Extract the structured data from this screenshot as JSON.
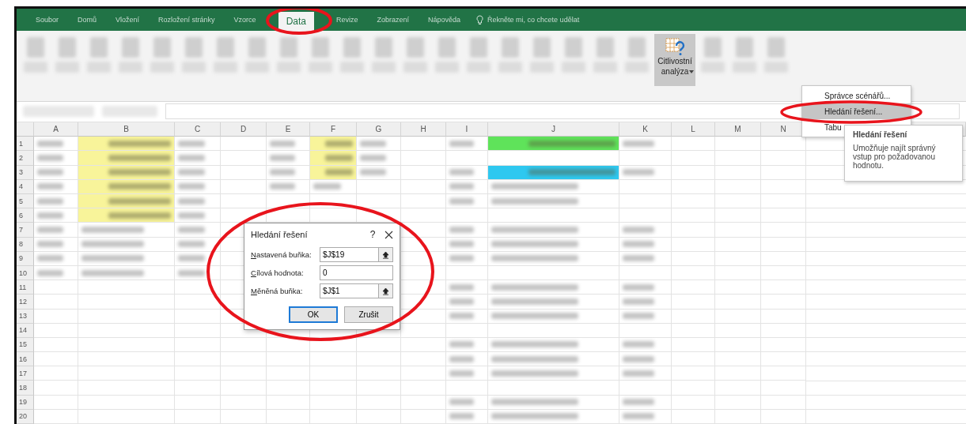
{
  "ribbon_tabs": [
    {
      "label": "Soubor",
      "selected": false
    },
    {
      "label": "Domů",
      "selected": false
    },
    {
      "label": "Vložení",
      "selected": false
    },
    {
      "label": "Rozložení stránky",
      "selected": false
    },
    {
      "label": "Vzorce",
      "selected": false
    },
    {
      "label": "Data",
      "selected": true
    },
    {
      "label": "Revize",
      "selected": false
    },
    {
      "label": "Zobrazení",
      "selected": false
    },
    {
      "label": "Nápověda",
      "selected": false
    }
  ],
  "tell_me": {
    "placeholder": "Řekněte mi, co chcete udělat"
  },
  "ribbon_items": [
    {
      "kind": "blurred"
    },
    {
      "kind": "blurred"
    },
    {
      "kind": "blurred"
    },
    {
      "kind": "blurred"
    },
    {
      "kind": "blurred"
    },
    {
      "kind": "blurred"
    },
    {
      "kind": "blurred"
    },
    {
      "kind": "blurred"
    },
    {
      "kind": "blurred"
    },
    {
      "kind": "blurred"
    },
    {
      "kind": "blurred"
    },
    {
      "kind": "blurred"
    },
    {
      "kind": "blurred"
    },
    {
      "kind": "blurred"
    },
    {
      "kind": "blurred"
    },
    {
      "kind": "blurred"
    },
    {
      "kind": "blurred"
    },
    {
      "kind": "blurred"
    },
    {
      "kind": "blurred"
    },
    {
      "kind": "blurred"
    },
    {
      "kind": "button",
      "lines": [
        "Citlivostní",
        "analýza"
      ],
      "pressed": true
    },
    {
      "kind": "blurred"
    },
    {
      "kind": "blurred"
    },
    {
      "kind": "blurred"
    }
  ],
  "dropdown_menu": {
    "items": [
      {
        "label": "Správce scénářů...",
        "highlighted": false
      },
      {
        "label": "Hledání řešení...",
        "highlighted": true
      },
      {
        "label": "Tabu",
        "highlighted": false
      }
    ]
  },
  "tooltip": {
    "title": "Hledání řešení",
    "text": "Umožňuje najít správný vstup pro požadovanou hodnotu."
  },
  "columns": [
    "A",
    "B",
    "C",
    "D",
    "E",
    "F",
    "G",
    "H",
    "I",
    "J",
    "K",
    "L",
    "M",
    "N"
  ],
  "rows": [
    {
      "number": "1",
      "cells": [
        {
          "blurred": true
        },
        {
          "blurred": true,
          "color": "#f8f49a"
        },
        {
          "blurred": true
        },
        {
          "blurred": false
        },
        {
          "blurred": true
        },
        {
          "blurred": true,
          "color": "#f8f49a"
        },
        {
          "blurred": true
        },
        {
          "blurred": false
        },
        {
          "blurred": true
        },
        {
          "blurred": true,
          "color": "#5fe35a"
        },
        {
          "blurred": true
        },
        {
          "blurred": false
        },
        {
          "blurred": false
        },
        {
          "blurred": false
        }
      ]
    },
    {
      "number": "2",
      "cells": [
        {
          "blurred": true
        },
        {
          "blurred": true,
          "color": "#f8f49a"
        },
        {
          "blurred": true
        },
        {
          "blurred": false
        },
        {
          "blurred": true
        },
        {
          "blurred": true,
          "color": "#f8f49a"
        },
        {
          "blurred": true
        },
        {
          "blurred": false
        },
        {
          "blurred": false
        },
        {
          "blurred": false
        },
        {
          "blurred": false
        },
        {
          "blurred": false
        },
        {
          "blurred": false
        },
        {
          "blurred": false
        }
      ]
    },
    {
      "number": "3",
      "cells": [
        {
          "blurred": true
        },
        {
          "blurred": true,
          "color": "#f8f49a"
        },
        {
          "blurred": true
        },
        {
          "blurred": false
        },
        {
          "blurred": true
        },
        {
          "blurred": true,
          "color": "#f8f49a"
        },
        {
          "blurred": true
        },
        {
          "blurred": false
        },
        {
          "blurred": true
        },
        {
          "blurred": true,
          "color": "#2ec8f0"
        },
        {
          "blurred": true
        },
        {
          "blurred": false
        },
        {
          "blurred": false
        },
        {
          "blurred": false
        }
      ]
    },
    {
      "number": "4",
      "cells": [
        {
          "blurred": true
        },
        {
          "blurred": true,
          "color": "#f8f49a"
        },
        {
          "blurred": true
        },
        {
          "blurred": false
        },
        {
          "blurred": true
        },
        {
          "blurred": true
        },
        {
          "blurred": false
        },
        {
          "blurred": false
        },
        {
          "blurred": true
        },
        {
          "blurred": true
        },
        {
          "blurred": false
        },
        {
          "blurred": false
        },
        {
          "blurred": false
        },
        {
          "blurred": false
        }
      ]
    },
    {
      "number": "5",
      "cells": [
        {
          "blurred": true
        },
        {
          "blurred": true,
          "color": "#f8f49a"
        },
        {
          "blurred": true
        },
        {
          "blurred": false
        },
        {
          "blurred": false
        },
        {
          "blurred": false
        },
        {
          "blurred": false
        },
        {
          "blurred": false
        },
        {
          "blurred": true
        },
        {
          "blurred": true
        },
        {
          "blurred": false
        },
        {
          "blurred": false
        },
        {
          "blurred": false
        },
        {
          "blurred": false
        }
      ]
    },
    {
      "number": "6",
      "cells": [
        {
          "blurred": true
        },
        {
          "blurred": true,
          "color": "#f8f49a"
        },
        {
          "blurred": true
        },
        {
          "blurred": false
        },
        {
          "blurred": false
        },
        {
          "blurred": false
        },
        {
          "blurred": false
        },
        {
          "blurred": false
        },
        {
          "blurred": false
        },
        {
          "blurred": false
        },
        {
          "blurred": false
        },
        {
          "blurred": false
        },
        {
          "blurred": false
        },
        {
          "blurred": false
        }
      ]
    },
    {
      "number": "7",
      "cells": [
        {
          "blurred": true
        },
        {
          "blurred": true
        },
        {
          "blurred": true
        },
        {
          "blurred": false
        },
        {},
        {},
        {},
        {
          "blurred": false
        },
        {
          "blurred": true
        },
        {
          "blurred": true
        },
        {
          "blurred": true
        },
        {
          "blurred": false
        },
        {
          "blurred": false
        },
        {
          "blurred": false
        }
      ]
    },
    {
      "number": "8",
      "cells": [
        {
          "blurred": true
        },
        {
          "blurred": true
        },
        {
          "blurred": true
        },
        {
          "blurred": false
        },
        {},
        {},
        {},
        {
          "blurred": false
        },
        {
          "blurred": true
        },
        {
          "blurred": true
        },
        {
          "blurred": true
        },
        {
          "blurred": false
        },
        {
          "blurred": false
        },
        {
          "blurred": false
        }
      ]
    },
    {
      "number": "9",
      "cells": [
        {
          "blurred": true
        },
        {
          "blurred": true
        },
        {
          "blurred": true
        },
        {
          "blurred": false
        },
        {},
        {},
        {},
        {
          "blurred": false
        },
        {
          "blurred": true
        },
        {
          "blurred": true
        },
        {
          "blurred": true
        },
        {
          "blurred": false
        },
        {
          "blurred": false
        },
        {
          "blurred": false
        }
      ]
    },
    {
      "number": "10",
      "cells": [
        {
          "blurred": true
        },
        {
          "blurred": true
        },
        {
          "blurred": true
        },
        {
          "blurred": false
        },
        {},
        {},
        {},
        {
          "blurred": false
        },
        {
          "blurred": false
        },
        {
          "blurred": false
        },
        {
          "blurred": false
        },
        {
          "blurred": false
        },
        {
          "blurred": false
        },
        {
          "blurred": false
        }
      ]
    },
    {
      "number": "11",
      "cells": [
        {
          "blurred": false
        },
        {
          "blurred": false
        },
        {
          "blurred": false
        },
        {
          "blurred": false
        },
        {},
        {},
        {},
        {
          "blurred": false
        },
        {
          "blurred": true
        },
        {
          "blurred": true
        },
        {
          "blurred": true
        },
        {
          "blurred": false
        },
        {
          "blurred": false
        },
        {
          "blurred": false
        }
      ]
    },
    {
      "number": "12",
      "cells": [
        {
          "blurred": false
        },
        {
          "blurred": false
        },
        {
          "blurred": false
        },
        {
          "blurred": false
        },
        {},
        {},
        {},
        {
          "blurred": false
        },
        {
          "blurred": true
        },
        {
          "blurred": true
        },
        {
          "blurred": true
        },
        {
          "blurred": false
        },
        {
          "blurred": false
        },
        {
          "blurred": false
        }
      ]
    },
    {
      "number": "13",
      "cells": [
        {
          "blurred": false
        },
        {
          "blurred": false
        },
        {
          "blurred": false
        },
        {
          "blurred": false
        },
        {},
        {},
        {},
        {
          "blurred": false
        },
        {
          "blurred": true
        },
        {
          "blurred": true
        },
        {
          "blurred": true
        },
        {
          "blurred": false
        },
        {
          "blurred": false
        },
        {
          "blurred": false
        }
      ]
    },
    {
      "number": "14",
      "cells": [
        {
          "blurred": false
        },
        {
          "blurred": false
        },
        {
          "blurred": false
        },
        {
          "blurred": false
        },
        {
          "blurred": false
        },
        {
          "blurred": false
        },
        {
          "blurred": false
        },
        {
          "blurred": false
        },
        {
          "blurred": false
        },
        {
          "blurred": false
        },
        {
          "blurred": false
        },
        {
          "blurred": false
        },
        {
          "blurred": false
        },
        {
          "blurred": false
        }
      ]
    },
    {
      "number": "15",
      "cells": [
        {
          "blurred": false
        },
        {
          "blurred": false
        },
        {
          "blurred": false
        },
        {
          "blurred": false
        },
        {
          "blurred": false
        },
        {
          "blurred": false
        },
        {
          "blurred": false
        },
        {
          "blurred": false
        },
        {
          "blurred": true
        },
        {
          "blurred": true
        },
        {
          "blurred": true
        },
        {
          "blurred": false
        },
        {
          "blurred": false
        },
        {
          "blurred": false
        }
      ]
    },
    {
      "number": "16",
      "cells": [
        {
          "blurred": false
        },
        {
          "blurred": false
        },
        {
          "blurred": false
        },
        {
          "blurred": false
        },
        {
          "blurred": false
        },
        {
          "blurred": false
        },
        {
          "blurred": false
        },
        {
          "blurred": false
        },
        {
          "blurred": true
        },
        {
          "blurred": true
        },
        {
          "blurred": true
        },
        {
          "blurred": false
        },
        {
          "blurred": false
        },
        {
          "blurred": false
        }
      ]
    },
    {
      "number": "17",
      "cells": [
        {
          "blurred": false
        },
        {
          "blurred": false
        },
        {
          "blurred": false
        },
        {
          "blurred": false
        },
        {
          "blurred": false
        },
        {
          "blurred": false
        },
        {
          "blurred": false
        },
        {
          "blurred": false
        },
        {
          "blurred": true
        },
        {
          "blurred": true
        },
        {
          "blurred": true
        },
        {
          "blurred": false
        },
        {
          "blurred": false
        },
        {
          "blurred": false
        }
      ]
    },
    {
      "number": "18",
      "cells": [
        {
          "blurred": false
        },
        {
          "blurred": false
        },
        {
          "blurred": false
        },
        {
          "blurred": false
        },
        {
          "blurred": false
        },
        {
          "blurred": false
        },
        {
          "blurred": false
        },
        {
          "blurred": false
        },
        {
          "blurred": false
        },
        {
          "blurred": false
        },
        {
          "blurred": false
        },
        {
          "blurred": false
        },
        {
          "blurred": false
        },
        {
          "blurred": false
        }
      ]
    },
    {
      "number": "19",
      "cells": [
        {
          "blurred": false
        },
        {
          "blurred": false
        },
        {
          "blurred": false
        },
        {
          "blurred": false
        },
        {
          "blurred": false
        },
        {
          "blurred": false
        },
        {
          "blurred": false
        },
        {
          "blurred": false
        },
        {
          "blurred": true
        },
        {
          "blurred": true
        },
        {
          "blurred": true
        },
        {
          "blurred": false
        },
        {
          "blurred": false
        },
        {
          "blurred": false
        }
      ]
    },
    {
      "number": "20",
      "cells": [
        {
          "blurred": false
        },
        {
          "blurred": false
        },
        {
          "blurred": false
        },
        {
          "blurred": false
        },
        {
          "blurred": false
        },
        {
          "blurred": false
        },
        {
          "blurred": false
        },
        {
          "blurred": false
        },
        {
          "blurred": true
        },
        {
          "blurred": true
        },
        {
          "blurred": true
        },
        {
          "blurred": false
        },
        {
          "blurred": false
        },
        {
          "blurred": false
        }
      ]
    }
  ],
  "dialog": {
    "title": "Hledání řešení",
    "help": "?",
    "fields": [
      {
        "label": "Nastavená buňka:",
        "value": "$J$19",
        "picker": true
      },
      {
        "label": "Cílová hodnota:",
        "value": "0",
        "picker": false
      },
      {
        "label": "Měněná buňka:",
        "value": "$J$1",
        "picker": true
      }
    ],
    "buttons": [
      {
        "label": "OK",
        "default": true
      },
      {
        "label": "Zrušit",
        "default": false
      }
    ]
  }
}
